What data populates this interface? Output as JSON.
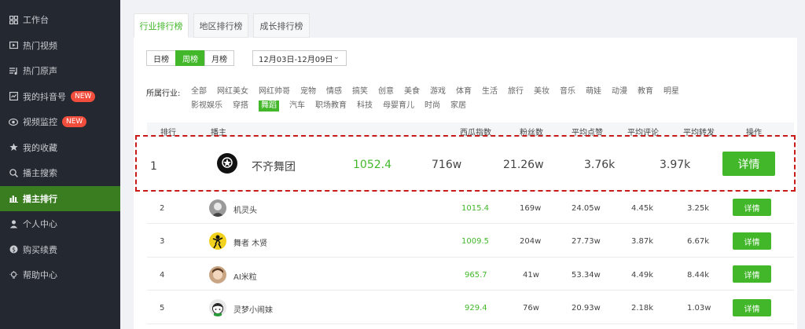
{
  "sidebar": {
    "items": [
      {
        "label": "工作台",
        "icon": "grid-icon"
      },
      {
        "label": "热门视频",
        "icon": "video-icon"
      },
      {
        "label": "热门原声",
        "icon": "music-list-icon"
      },
      {
        "label": "我的抖音号",
        "icon": "chart-icon",
        "badge": "NEW"
      },
      {
        "label": "视频监控",
        "icon": "eye-icon",
        "badge": "NEW"
      },
      {
        "label": "我的收藏",
        "icon": "star-icon"
      },
      {
        "label": "播主搜索",
        "icon": "search-icon"
      },
      {
        "label": "播主排行",
        "icon": "bar-chart-icon",
        "active": true
      },
      {
        "label": "个人中心",
        "icon": "user-icon"
      },
      {
        "label": "购买续费",
        "icon": "coin-icon"
      },
      {
        "label": "帮助中心",
        "icon": "bulb-icon"
      }
    ]
  },
  "tabs": [
    "行业排行榜",
    "地区排行榜",
    "成长排行榜"
  ],
  "periods": [
    "日榜",
    "周榜",
    "月榜"
  ],
  "date_range": "12月03日-12月09日",
  "industry_label": "所属行业:",
  "industries_row1": [
    "全部",
    "网红美女",
    "网红帅哥",
    "宠物",
    "情感",
    "搞笑",
    "创意",
    "美食",
    "游戏",
    "体育",
    "生活",
    "旅行",
    "美妆",
    "音乐",
    "萌娃",
    "动漫",
    "教育",
    "明星"
  ],
  "industries_row2": [
    "影视娱乐",
    "穿搭",
    "舞蹈",
    "汽车",
    "职场教育",
    "科技",
    "母婴育儿",
    "时尚",
    "家居"
  ],
  "table": {
    "headers": {
      "rank": "排行",
      "creator": "播主",
      "xigua": "西瓜指数",
      "fans": "粉丝数",
      "likes": "平均点赞",
      "comments": "平均评论",
      "shares": "平均转发",
      "action": "操作"
    },
    "rows": [
      {
        "rank": "1",
        "name": "不齐舞团",
        "xigua": "1052.4",
        "fans": "716w",
        "likes": "21.26w",
        "comments": "3.76k",
        "shares": "3.97k",
        "action": "详情"
      },
      {
        "rank": "2",
        "name": "机灵头",
        "xigua": "1015.4",
        "fans": "169w",
        "likes": "24.05w",
        "comments": "4.45k",
        "shares": "3.25k",
        "action": "详情"
      },
      {
        "rank": "3",
        "name": "舞者 木贤",
        "xigua": "1009.5",
        "fans": "204w",
        "likes": "27.73w",
        "comments": "3.87k",
        "shares": "6.67k",
        "action": "详情"
      },
      {
        "rank": "4",
        "name": "AI米粒",
        "xigua": "965.7",
        "fans": "41w",
        "likes": "53.34w",
        "comments": "4.49k",
        "shares": "8.44k",
        "action": "详情"
      },
      {
        "rank": "5",
        "name": "灵梦小闹妹",
        "xigua": "929.4",
        "fans": "76w",
        "likes": "20.93w",
        "comments": "2.18k",
        "shares": "1.03w",
        "action": "详情"
      }
    ]
  },
  "colors": {
    "accent": "#42b72a",
    "sidebar_bg": "#242830",
    "highlight": "#c91a1a"
  }
}
